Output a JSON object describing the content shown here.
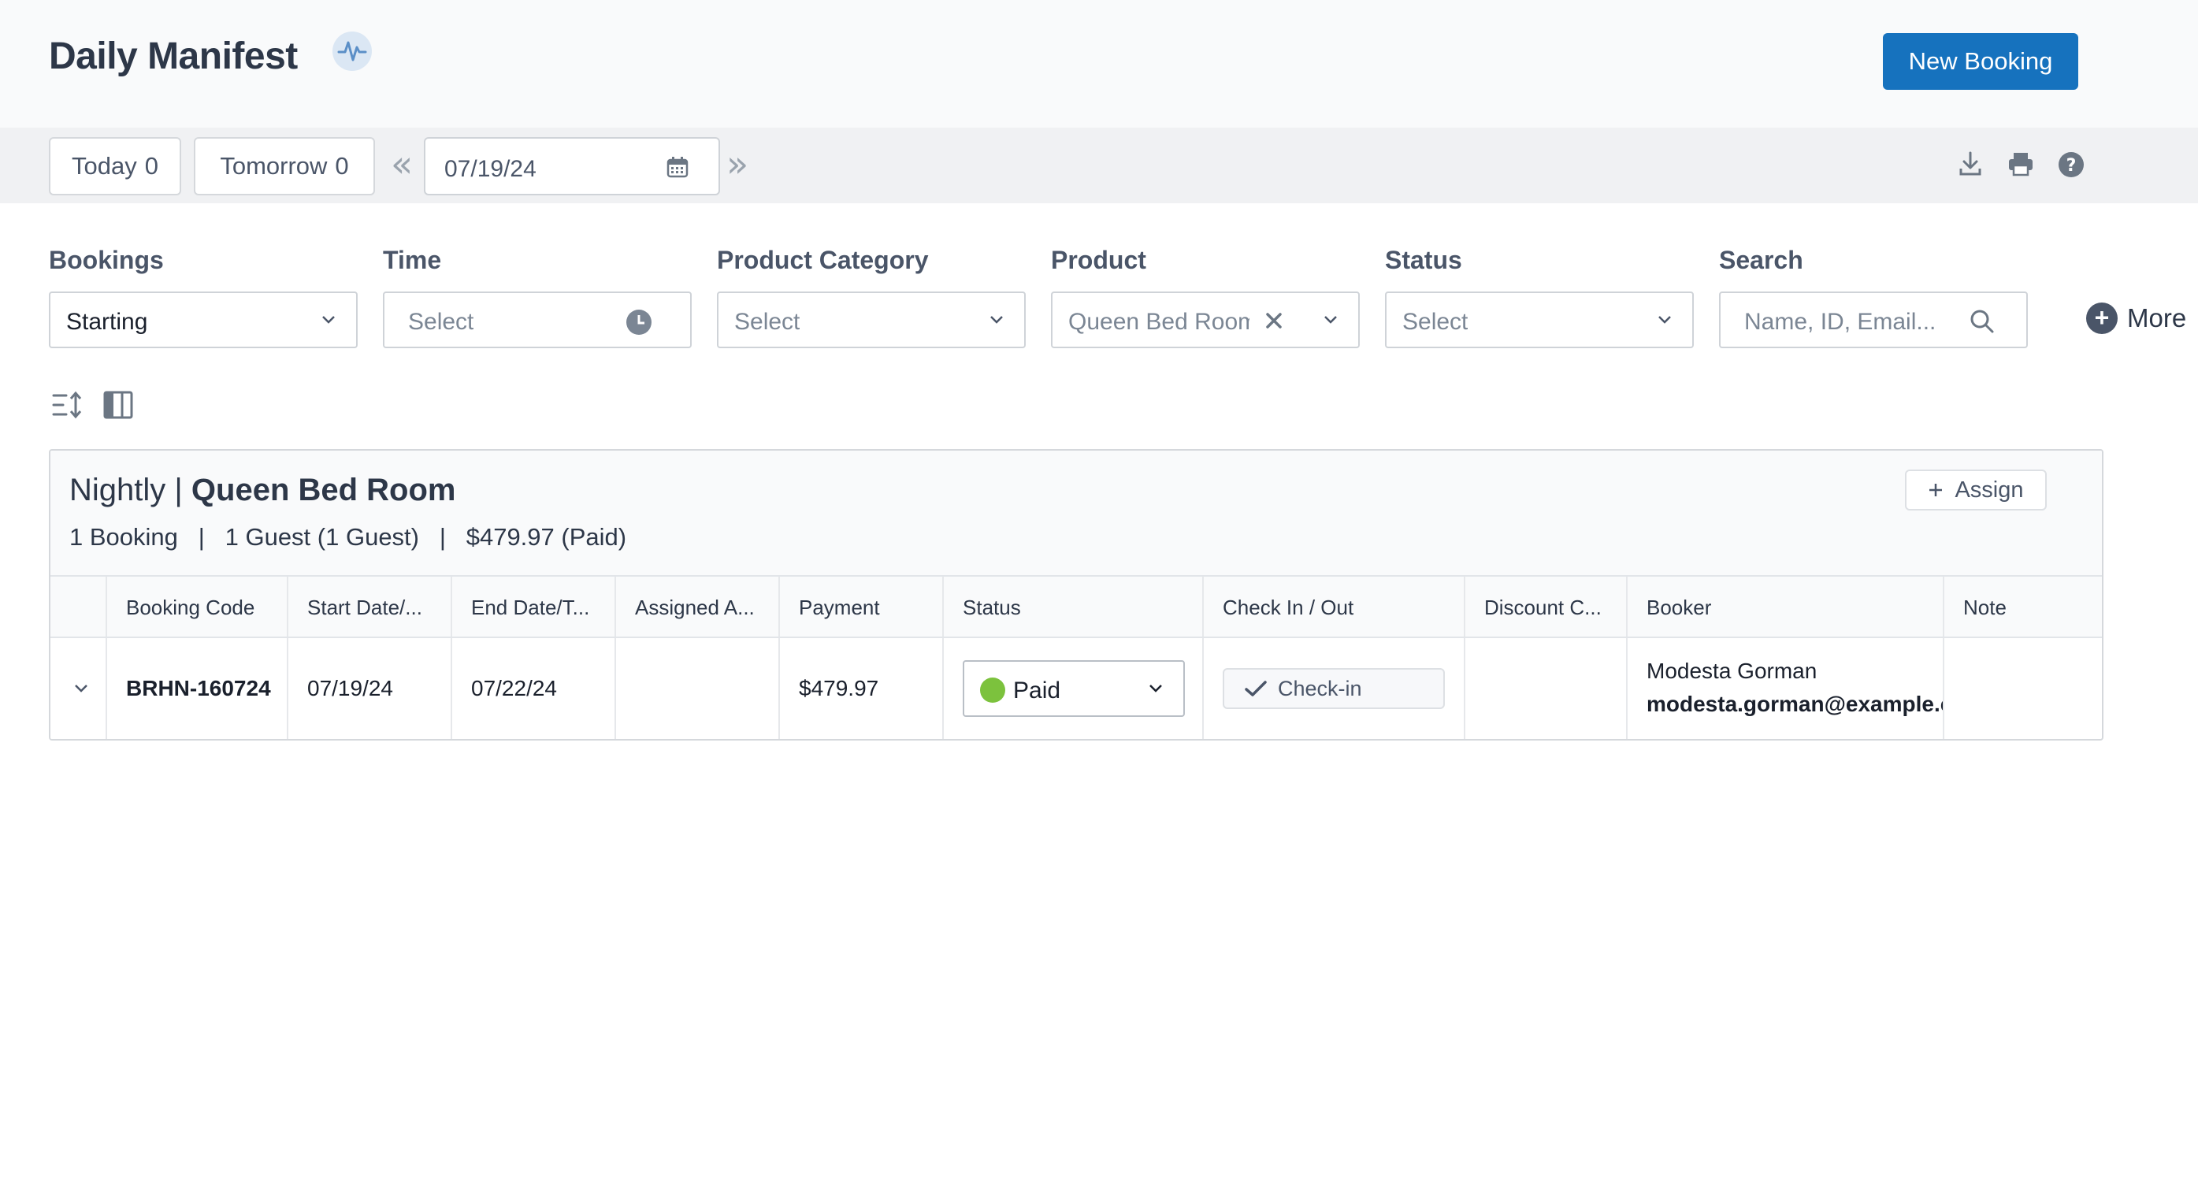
{
  "header": {
    "title": "Daily Manifest",
    "new_booking_label": "New Booking"
  },
  "toolbar": {
    "today_label": "Today",
    "today_count": "0",
    "tomorrow_label": "Tomorrow",
    "tomorrow_count": "0",
    "date_value": "07/19/24",
    "prev_glyph": "«",
    "next_glyph": "»"
  },
  "filters": {
    "bookings": {
      "label": "Bookings",
      "value": "Starting"
    },
    "time": {
      "label": "Time",
      "placeholder": "Select"
    },
    "product_category": {
      "label": "Product Category",
      "placeholder": "Select"
    },
    "product": {
      "label": "Product",
      "value": "Queen Bed Room"
    },
    "status": {
      "label": "Status",
      "placeholder": "Select"
    },
    "search": {
      "label": "Search",
      "placeholder": "Name, ID, Email..."
    },
    "more_label": "More"
  },
  "panel": {
    "rate_type": "Nightly |",
    "product_name": "Queen Bed Room",
    "summary": "1 Booking   |   1 Guest (1 Guest)   |   $479.97 (Paid)",
    "assign_label": "Assign"
  },
  "table": {
    "columns": [
      "Booking Code",
      "Start Date/...",
      "End Date/T...",
      "Assigned A...",
      "Payment",
      "Status",
      "Check In / Out",
      "Discount C...",
      "Booker",
      "Note"
    ],
    "rows": [
      {
        "booking_code": "BRHN-160724",
        "start_date": "07/19/24",
        "end_date": "07/22/24",
        "assigned": "",
        "payment": "$479.97",
        "status": "Paid",
        "checkin_label": "Check-in",
        "discount": "",
        "booker_name": "Modesta Gorman",
        "booker_email": "modesta.gorman@example.com",
        "note": ""
      }
    ]
  },
  "colors": {
    "primary": "#1672be",
    "paid_dot": "#7cc23d",
    "text_dark": "#2d3748"
  },
  "icons": [
    "pulse-icon",
    "calendar-icon",
    "download-icon",
    "print-icon",
    "help-icon",
    "clock-icon",
    "clear-icon",
    "chevron-down-icon",
    "search-icon",
    "plus-icon",
    "sort-icon",
    "columns-icon",
    "check-icon"
  ]
}
